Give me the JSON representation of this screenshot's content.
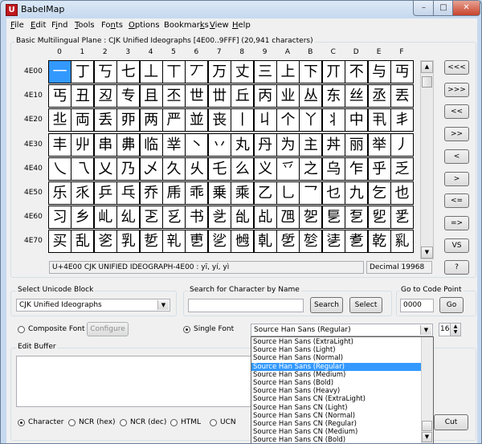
{
  "window": {
    "title": "BabelMap",
    "app_icon": "U",
    "minimize": "–",
    "maximize": "□",
    "close": "✕"
  },
  "menu": [
    "File",
    "Edit",
    "Find",
    "Tools",
    "Fonts",
    "Options",
    "Bookmarks",
    "View",
    "Help"
  ],
  "menu_mnemonic_index": [
    0,
    0,
    1,
    0,
    2,
    0,
    7,
    0,
    0
  ],
  "grid": {
    "title": "Basic Multilingual Plane : CJK Unified Ideographs [4E00..9FFF] (20,941 characters)",
    "columns": [
      "0",
      "1",
      "2",
      "3",
      "4",
      "5",
      "6",
      "7",
      "8",
      "9",
      "A",
      "B",
      "C",
      "D",
      "E",
      "F"
    ],
    "rows": [
      {
        "label": "4E00",
        "chars": [
          "一",
          "丁",
          "丂",
          "七",
          "丄",
          "丅",
          "丆",
          "万",
          "丈",
          "三",
          "上",
          "下",
          "丌",
          "不",
          "与",
          "丏"
        ]
      },
      {
        "label": "4E10",
        "chars": [
          "丐",
          "丑",
          "丒",
          "专",
          "且",
          "丕",
          "世",
          "丗",
          "丘",
          "丙",
          "业",
          "丛",
          "东",
          "丝",
          "丞",
          "丟"
        ]
      },
      {
        "label": "4E20",
        "chars": [
          "丠",
          "両",
          "丢",
          "丣",
          "两",
          "严",
          "並",
          "丧",
          "丨",
          "丩",
          "个",
          "丫",
          "丬",
          "中",
          "丮",
          "丯"
        ]
      },
      {
        "label": "4E30",
        "chars": [
          "丰",
          "丱",
          "串",
          "丳",
          "临",
          "丵",
          "丶",
          "丷",
          "丸",
          "丹",
          "为",
          "主",
          "丼",
          "丽",
          "举",
          "丿"
        ]
      },
      {
        "label": "4E40",
        "chars": [
          "乀",
          "乁",
          "乂",
          "乃",
          "乄",
          "久",
          "乆",
          "乇",
          "么",
          "义",
          "乊",
          "之",
          "乌",
          "乍",
          "乎",
          "乏"
        ]
      },
      {
        "label": "4E50",
        "chars": [
          "乐",
          "乑",
          "乒",
          "乓",
          "乔",
          "乕",
          "乖",
          "乗",
          "乘",
          "乙",
          "乚",
          "乛",
          "乜",
          "九",
          "乞",
          "也"
        ]
      },
      {
        "label": "4E60",
        "chars": [
          "习",
          "乡",
          "乢",
          "乣",
          "乤",
          "乥",
          "书",
          "乧",
          "乨",
          "乩",
          "乪",
          "乫",
          "乬",
          "乭",
          "乮",
          "乯"
        ]
      },
      {
        "label": "4E70",
        "chars": [
          "买",
          "乱",
          "乲",
          "乳",
          "乴",
          "乵",
          "乶",
          "乷",
          "乸",
          "乹",
          "乺",
          "乻",
          "乼",
          "乽",
          "乾",
          "乿"
        ]
      }
    ],
    "selected": "4E00-0",
    "status_name": "U+4E00 CJK UNIFIED IDEOGRAPH-4E00 : yī, yí, yì",
    "status_decimal": "Decimal 19968"
  },
  "nav_buttons": [
    "<<<",
    ">>>",
    "<<",
    ">>",
    "<",
    ">",
    "<=",
    "=>",
    "VS",
    "?"
  ],
  "scroll_arrows": {
    "up": "▲",
    "down": "▼"
  },
  "unicode_block": {
    "label": "Select Unicode Block",
    "value": "CJK Unified Ideographs"
  },
  "search": {
    "label": "Search for Character by Name",
    "value": "",
    "search_button": "Search",
    "select_button": "Select"
  },
  "goto": {
    "label": "Go to Code Point",
    "value": "0000",
    "button": "Go"
  },
  "font_mode": {
    "composite_label": "Composite Font",
    "configure_button": "Configure",
    "single_label": "Single Font",
    "single_selected": true
  },
  "font_select": {
    "value": "Source Han Sans (Regular)",
    "size": "16"
  },
  "font_list": [
    "Source Han Sans (ExtraLight)",
    "Source Han Sans (Light)",
    "Source Han Sans (Normal)",
    "Source Han Sans (Regular)",
    "Source Han Sans (Medium)",
    "Source Han Sans (Bold)",
    "Source Han Sans (Heavy)",
    "Source Han Sans CN (ExtraLight)",
    "Source Han Sans CN (Light)",
    "Source Han Sans CN (Normal)",
    "Source Han Sans CN (Regular)",
    "Source Han Sans CN (Medium)",
    "Source Han Sans CN (Bold)"
  ],
  "font_list_highlighted": 3,
  "edit_buffer": {
    "label": "Edit Buffer",
    "value": "",
    "cut_button": "Cut"
  },
  "output_format": {
    "options": [
      "Character",
      "NCR (hex)",
      "NCR (dec)",
      "HTML",
      "UCN"
    ],
    "selected": 0
  }
}
